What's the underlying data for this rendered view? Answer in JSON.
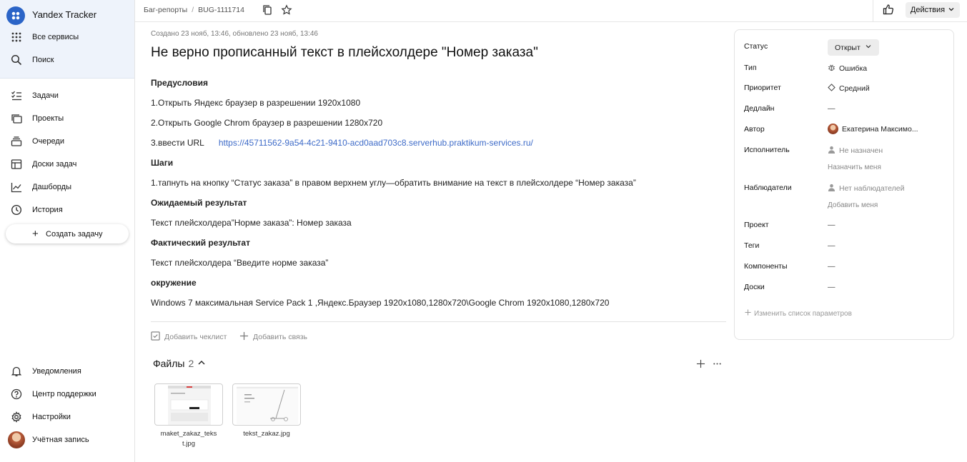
{
  "sidebar": {
    "brand": "Yandex Tracker",
    "top_items": [
      {
        "label": "Все сервисы",
        "icon": "grid-icon"
      },
      {
        "label": "Поиск",
        "icon": "search-icon"
      }
    ],
    "nav_items": [
      {
        "label": "Задачи",
        "icon": "tasks-icon"
      },
      {
        "label": "Проекты",
        "icon": "projects-icon"
      },
      {
        "label": "Очереди",
        "icon": "queues-icon"
      },
      {
        "label": "Доски задач",
        "icon": "boards-icon"
      },
      {
        "label": "Дашборды",
        "icon": "dashboards-icon"
      },
      {
        "label": "История",
        "icon": "history-icon"
      }
    ],
    "create_label": "Создать задачу",
    "bottom_items": [
      {
        "label": "Уведомления",
        "icon": "bell-icon"
      },
      {
        "label": "Центр поддержки",
        "icon": "help-icon"
      },
      {
        "label": "Настройки",
        "icon": "gear-icon"
      },
      {
        "label": "Учётная запись",
        "icon": "avatar"
      }
    ]
  },
  "header": {
    "breadcrumb_queue": "Баг-репорты",
    "breadcrumb_sep": "/",
    "breadcrumb_key": "BUG-1111714",
    "actions_label": "Действия"
  },
  "issue": {
    "meta": "Создано 23 нояб, 13:46, обновлено 23 нояб, 13:46",
    "title": "Не верно прописанный текст в плейсхолдере \"Номер заказа\"",
    "desc": {
      "pre_heading": "Предусловия",
      "pre_1": "1.Открыть Яндекс браузер в разрешении 1920х1080",
      "pre_2": "2.Открыть Google Chrom браузер в разрешении 1280х720",
      "pre_3": "3.ввести URL",
      "url": "https://45711562-9a54-4c21-9410-acd0aad703c8.serverhub.praktikum-services.ru/",
      "steps_heading": "Шаги",
      "step_1": "1.тапнуть на кнопку “Статус заказа” в правом верхнем углу—обратить внимание на текст в плейсхолдере “Номер заказа”",
      "expected_heading": "Ожидаемый результат",
      "expected": "Текст плейсхолдера”Норме заказа”: Номер заказа",
      "actual_heading": "Фактический результат",
      "actual": "Текст плейсхолдера “Введите норме заказа”",
      "env_heading": "окружение",
      "env": "Windows 7 максимальная Service Pack 1 ,Яндекс.Браузер 1920х1080,1280х720\\Google Chrom 1920х1080,1280х720"
    },
    "add_checklist": "Добавить чеклист",
    "add_link": "Добавить связь",
    "files_label": "Файлы",
    "files_count": "2",
    "files": [
      {
        "name_1": "maket_zakaz_teks",
        "name_2": "t.jpg"
      },
      {
        "name_1": "tekst_zakaz.jpg",
        "name_2": ""
      }
    ]
  },
  "panel": {
    "status_label": "Статус",
    "status_value": "Открыт",
    "type_label": "Тип",
    "type_value": "Ошибка",
    "priority_label": "Приоритет",
    "priority_value": "Средний",
    "deadline_label": "Дедлайн",
    "deadline_value": "—",
    "author_label": "Автор",
    "author_value": "Екатерина Максимо...",
    "assignee_label": "Исполнитель",
    "assignee_value": "Не назначен",
    "assign_me": "Назначить меня",
    "followers_label": "Наблюдатели",
    "followers_value": "Нет наблюдателей",
    "add_me": "Добавить меня",
    "project_label": "Проект",
    "project_value": "—",
    "tags_label": "Теги",
    "tags_value": "—",
    "components_label": "Компоненты",
    "components_value": "—",
    "boards_label": "Доски",
    "boards_value": "—",
    "edit_params": "Изменить список параметров"
  }
}
